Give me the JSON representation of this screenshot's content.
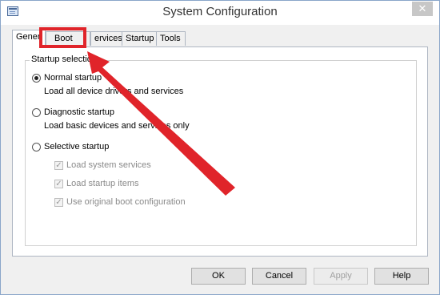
{
  "window": {
    "title": "System Configuration",
    "close_glyph": "✕",
    "icon": "system-config-icon"
  },
  "tabs": [
    {
      "label": "General",
      "visible_label": "Gener",
      "active": true
    },
    {
      "label": "Boot",
      "active": false
    },
    {
      "label": "Services",
      "visible_label": "ervices",
      "active": false
    },
    {
      "label": "Startup",
      "active": false
    },
    {
      "label": "Tools",
      "active": false
    }
  ],
  "startup_selection": {
    "group_label": "Startup selection",
    "options": [
      {
        "label": "Normal startup",
        "description": "Load all device drivers and services",
        "selected": true
      },
      {
        "label": "Diagnostic startup",
        "description": "Load basic devices and services only",
        "selected": false
      },
      {
        "label": "Selective startup",
        "description": "",
        "selected": false
      }
    ],
    "selective_items": [
      {
        "label": "Load system services",
        "checked": true,
        "enabled": false
      },
      {
        "label": "Load startup items",
        "checked": true,
        "enabled": false
      },
      {
        "label": "Use original boot configuration",
        "checked": true,
        "enabled": false
      }
    ]
  },
  "buttons": {
    "ok": "OK",
    "cancel": "Cancel",
    "apply": "Apply",
    "help": "Help"
  },
  "annotation": {
    "color": "#e0242a",
    "target": "Boot"
  }
}
